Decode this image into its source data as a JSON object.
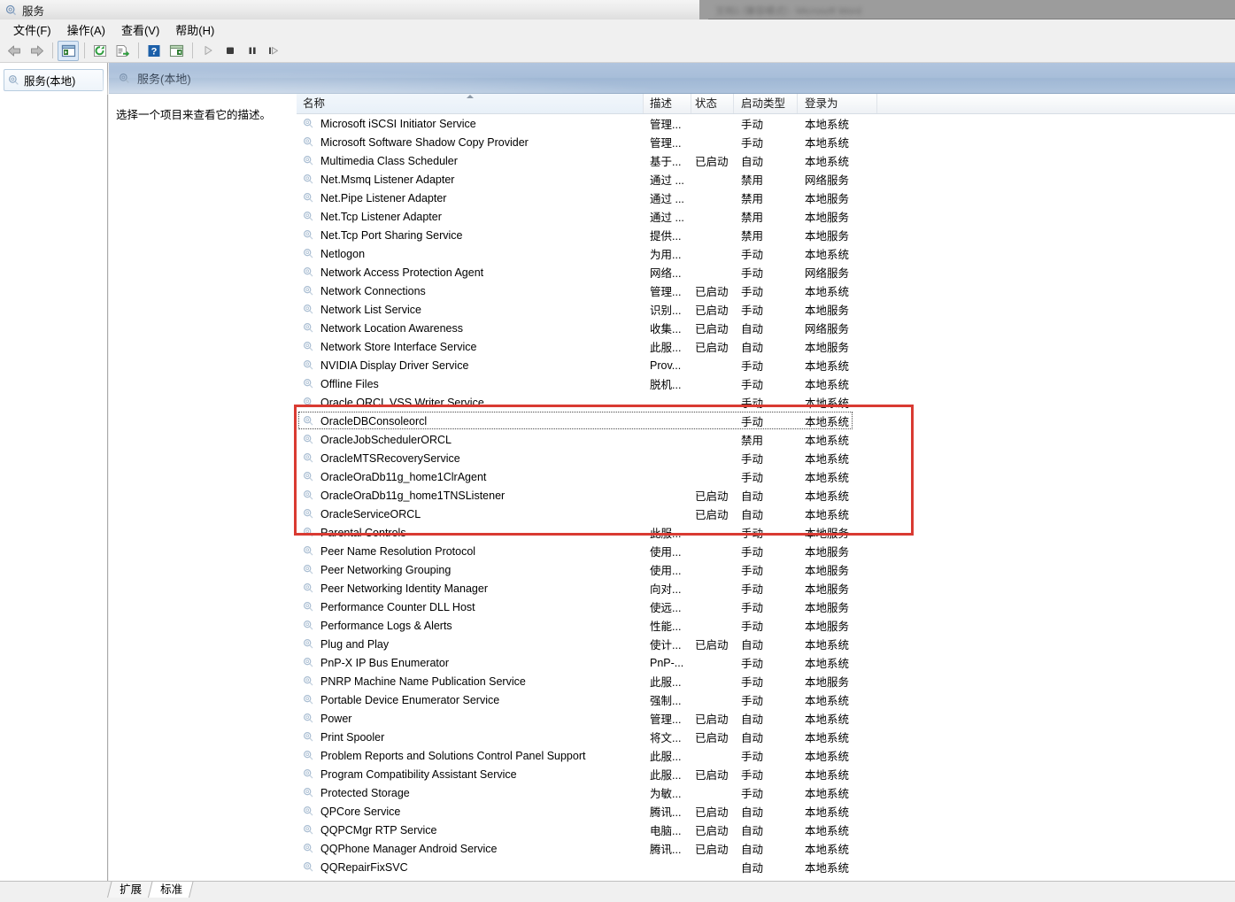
{
  "background_window": {
    "title_blurred": "文档1 [兼容模式] - Microsoft Word"
  },
  "window": {
    "title": "服务",
    "icon": "services-gear-icon"
  },
  "menubar": {
    "items": [
      {
        "label": "文件(F)",
        "name": "menu-file"
      },
      {
        "label": "操作(A)",
        "name": "menu-action"
      },
      {
        "label": "查看(V)",
        "name": "menu-view"
      },
      {
        "label": "帮助(H)",
        "name": "menu-help"
      }
    ]
  },
  "toolbar": {
    "buttons": [
      {
        "name": "back-arrow-icon",
        "title": "后退"
      },
      {
        "name": "forward-arrow-icon",
        "title": "前进"
      },
      {
        "name": "show-hide-console-tree-icon",
        "title": "显示/隐藏控制台树",
        "pressed": true
      },
      {
        "name": "refresh-icon",
        "title": "刷新"
      },
      {
        "name": "export-list-icon",
        "title": "导出列表"
      },
      {
        "name": "help-icon",
        "title": "帮助"
      },
      {
        "name": "show-hide-action-pane-icon",
        "title": "显示/隐藏操作窗格"
      },
      {
        "name": "start-service-icon",
        "title": "启动服务"
      },
      {
        "name": "stop-service-icon",
        "title": "停止服务"
      },
      {
        "name": "pause-service-icon",
        "title": "暂停服务"
      },
      {
        "name": "restart-service-icon",
        "title": "重启服务"
      }
    ]
  },
  "sidebar": {
    "items": [
      {
        "label": "服务(本地)",
        "name": "tree-item-services-local",
        "selected": true
      }
    ]
  },
  "pane": {
    "header_title": "服务(本地)",
    "description_prompt": "选择一个项目来查看它的描述。"
  },
  "list": {
    "columns": [
      {
        "key": "name",
        "label": "名称",
        "sorted": true
      },
      {
        "key": "desc",
        "label": "描述"
      },
      {
        "key": "status",
        "label": "状态"
      },
      {
        "key": "start",
        "label": "启动类型"
      },
      {
        "key": "logon",
        "label": "登录为"
      }
    ],
    "rows": [
      {
        "name": "Microsoft iSCSI Initiator Service",
        "desc": "管理...",
        "status": "",
        "start": "手动",
        "logon": "本地系统"
      },
      {
        "name": "Microsoft Software Shadow Copy Provider",
        "desc": "管理...",
        "status": "",
        "start": "手动",
        "logon": "本地系统"
      },
      {
        "name": "Multimedia Class Scheduler",
        "desc": "基于...",
        "status": "已启动",
        "start": "自动",
        "logon": "本地系统"
      },
      {
        "name": "Net.Msmq Listener Adapter",
        "desc": "通过 ...",
        "status": "",
        "start": "禁用",
        "logon": "网络服务"
      },
      {
        "name": "Net.Pipe Listener Adapter",
        "desc": "通过 ...",
        "status": "",
        "start": "禁用",
        "logon": "本地服务"
      },
      {
        "name": "Net.Tcp Listener Adapter",
        "desc": "通过 ...",
        "status": "",
        "start": "禁用",
        "logon": "本地服务"
      },
      {
        "name": "Net.Tcp Port Sharing Service",
        "desc": "提供...",
        "status": "",
        "start": "禁用",
        "logon": "本地服务"
      },
      {
        "name": "Netlogon",
        "desc": "为用...",
        "status": "",
        "start": "手动",
        "logon": "本地系统"
      },
      {
        "name": "Network Access Protection Agent",
        "desc": "网络...",
        "status": "",
        "start": "手动",
        "logon": "网络服务"
      },
      {
        "name": "Network Connections",
        "desc": "管理...",
        "status": "已启动",
        "start": "手动",
        "logon": "本地系统"
      },
      {
        "name": "Network List Service",
        "desc": "识别...",
        "status": "已启动",
        "start": "手动",
        "logon": "本地服务"
      },
      {
        "name": "Network Location Awareness",
        "desc": "收集...",
        "status": "已启动",
        "start": "自动",
        "logon": "网络服务"
      },
      {
        "name": "Network Store Interface Service",
        "desc": "此服...",
        "status": "已启动",
        "start": "自动",
        "logon": "本地服务"
      },
      {
        "name": "NVIDIA Display Driver Service",
        "desc": "Prov...",
        "status": "",
        "start": "手动",
        "logon": "本地系统"
      },
      {
        "name": "Offline Files",
        "desc": "脱机...",
        "status": "",
        "start": "手动",
        "logon": "本地系统"
      },
      {
        "name": "Oracle ORCL VSS Writer Service",
        "desc": "",
        "status": "",
        "start": "手动",
        "logon": "本地系统",
        "highlighted": true
      },
      {
        "name": "OracleDBConsoleorcl",
        "desc": "",
        "status": "",
        "start": "手动",
        "logon": "本地系统",
        "highlighted": true,
        "focused": true
      },
      {
        "name": "OracleJobSchedulerORCL",
        "desc": "",
        "status": "",
        "start": "禁用",
        "logon": "本地系统",
        "highlighted": true
      },
      {
        "name": "OracleMTSRecoveryService",
        "desc": "",
        "status": "",
        "start": "手动",
        "logon": "本地系统",
        "highlighted": true
      },
      {
        "name": "OracleOraDb11g_home1ClrAgent",
        "desc": "",
        "status": "",
        "start": "手动",
        "logon": "本地系统",
        "highlighted": true
      },
      {
        "name": "OracleOraDb11g_home1TNSListener",
        "desc": "",
        "status": "已启动",
        "start": "自动",
        "logon": "本地系统",
        "highlighted": true
      },
      {
        "name": "OracleServiceORCL",
        "desc": "",
        "status": "已启动",
        "start": "自动",
        "logon": "本地系统",
        "highlighted": true
      },
      {
        "name": "Parental Controls",
        "desc": "此服...",
        "status": "",
        "start": "手动",
        "logon": "本地服务"
      },
      {
        "name": "Peer Name Resolution Protocol",
        "desc": "使用...",
        "status": "",
        "start": "手动",
        "logon": "本地服务"
      },
      {
        "name": "Peer Networking Grouping",
        "desc": "使用...",
        "status": "",
        "start": "手动",
        "logon": "本地服务"
      },
      {
        "name": "Peer Networking Identity Manager",
        "desc": "向对...",
        "status": "",
        "start": "手动",
        "logon": "本地服务"
      },
      {
        "name": "Performance Counter DLL Host",
        "desc": "使远...",
        "status": "",
        "start": "手动",
        "logon": "本地服务"
      },
      {
        "name": "Performance Logs & Alerts",
        "desc": "性能...",
        "status": "",
        "start": "手动",
        "logon": "本地服务"
      },
      {
        "name": "Plug and Play",
        "desc": "使计...",
        "status": "已启动",
        "start": "自动",
        "logon": "本地系统"
      },
      {
        "name": "PnP-X IP Bus Enumerator",
        "desc": "PnP-...",
        "status": "",
        "start": "手动",
        "logon": "本地系统"
      },
      {
        "name": "PNRP Machine Name Publication Service",
        "desc": "此服...",
        "status": "",
        "start": "手动",
        "logon": "本地服务"
      },
      {
        "name": "Portable Device Enumerator Service",
        "desc": "强制...",
        "status": "",
        "start": "手动",
        "logon": "本地系统"
      },
      {
        "name": "Power",
        "desc": "管理...",
        "status": "已启动",
        "start": "自动",
        "logon": "本地系统"
      },
      {
        "name": "Print Spooler",
        "desc": "将文...",
        "status": "已启动",
        "start": "自动",
        "logon": "本地系统"
      },
      {
        "name": "Problem Reports and Solutions Control Panel Support",
        "desc": "此服...",
        "status": "",
        "start": "手动",
        "logon": "本地系统"
      },
      {
        "name": "Program Compatibility Assistant Service",
        "desc": "此服...",
        "status": "已启动",
        "start": "手动",
        "logon": "本地系统"
      },
      {
        "name": "Protected Storage",
        "desc": "为敏...",
        "status": "",
        "start": "手动",
        "logon": "本地系统"
      },
      {
        "name": "QPCore Service",
        "desc": "腾讯...",
        "status": "已启动",
        "start": "自动",
        "logon": "本地系统"
      },
      {
        "name": "QQPCMgr RTP Service",
        "desc": "电脑...",
        "status": "已启动",
        "start": "自动",
        "logon": "本地系统"
      },
      {
        "name": "QQPhone Manager Android Service",
        "desc": "腾讯...",
        "status": "已启动",
        "start": "自动",
        "logon": "本地系统"
      },
      {
        "name": "QQRepairFixSVC",
        "desc": "",
        "status": "",
        "start": "自动",
        "logon": "本地系统"
      }
    ]
  },
  "annotation": {
    "red_box_color": "#d93a32",
    "covers_rows": "Oracle ORCL VSS Writer Service 至 OracleServiceORCL"
  },
  "tabs": [
    {
      "label": "扩展",
      "name": "tab-extended",
      "active": false
    },
    {
      "label": "标准",
      "name": "tab-standard",
      "active": true
    }
  ]
}
